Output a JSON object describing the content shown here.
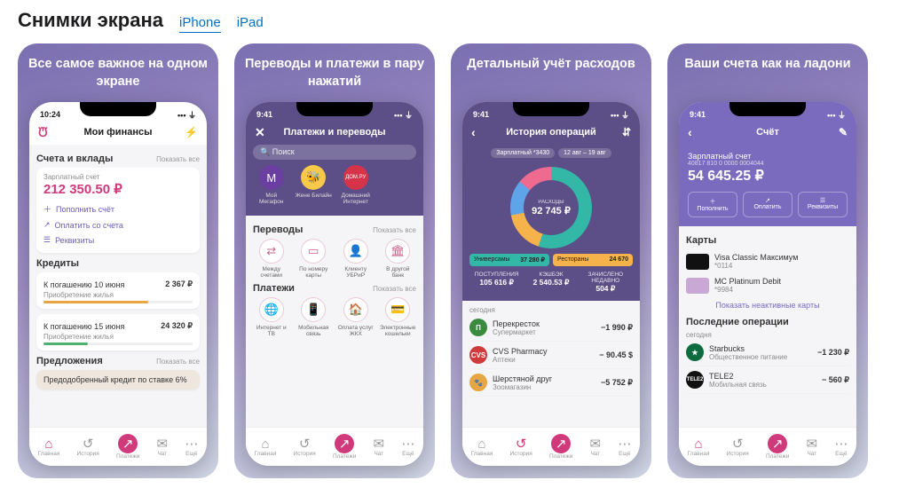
{
  "header": {
    "title": "Снимки экрана",
    "tab_iphone": "iPhone",
    "tab_ipad": "iPad"
  },
  "common": {
    "show_all": "Показать все",
    "today": "сегодня"
  },
  "tabbar": {
    "home": "Главная",
    "history": "История",
    "payments": "Платежи",
    "chat": "Чат",
    "more": "Ещё"
  },
  "shot1": {
    "caption": "Все самое важное на одном экране",
    "time": "10:24",
    "screen_title": "Мои финансы",
    "sec_accounts": "Счета и вклады",
    "account_name": "Зарплатный счет",
    "account_balance": "212 350.50 ₽",
    "act_topup": "Пополнить счёт",
    "act_pay": "Оплатить со счета",
    "act_details": "Реквизиты",
    "sec_credits": "Кредиты",
    "credit1_t": "К погашению 10 июня",
    "credit1_v": "2 367 ₽",
    "credit1_s": "Приобретение жилья",
    "credit2_t": "К погашению 15 июня",
    "credit2_v": "24 320 ₽",
    "credit2_s": "Приобретение жилья",
    "sec_offers": "Предложения",
    "offer": "Предодобренный кредит по ставке 6%"
  },
  "shot2": {
    "caption": "Переводы и платежи в пару нажатий",
    "time": "9:41",
    "screen_title": "Платежи и переводы",
    "search_ph": "Поиск",
    "fav1": "Мой Мегафон",
    "fav2": "Жене Билайн",
    "fav3": "Домашний Интернет",
    "sec_transfers": "Переводы",
    "t1": "Между счетами",
    "t2": "По номеру карты",
    "t3": "Клиенту УБРиР",
    "t4": "В другой банк",
    "sec_payments": "Платежи",
    "p1": "Интернет и ТВ",
    "p2": "Мобильная связь",
    "p3": "Оплата услуг ЖКХ",
    "p4": "Электронные кошельки"
  },
  "shot3": {
    "caption": "Детальный учёт расходов",
    "time": "9:41",
    "screen_title": "История операций",
    "pill_card": "Зарплатный *3430",
    "pill_period": "12 авг – 19 авг",
    "donut_label": "РАСХОДЫ",
    "donut_value": "92 745 ₽",
    "chip1_t": "Универсамы",
    "chip1_v": "37 280 ₽",
    "chip2_t": "Рестораны",
    "chip2_v": "24 670",
    "stat1_l": "ПОСТУПЛЕНИЯ",
    "stat1_v": "105 616 ₽",
    "stat2_l": "КЭШБЭК",
    "stat2_v": "2 540.53 ₽",
    "stat3_l": "ЗАЧИСЛЕНО НЕДАВНО",
    "stat3_v": "504 ₽",
    "op1_t": "Перекресток",
    "op1_s": "Супермаркет",
    "op1_v": "−1 990 ₽",
    "op2_t": "CVS Pharmacy",
    "op2_s": "Аптеки",
    "op2_v": "− 90.45 $",
    "op3_t": "Шерстяной друг",
    "op3_s": "Зоомагазин",
    "op3_v": "−5 752 ₽"
  },
  "shot4": {
    "caption": "Ваши счета как на ладони",
    "time": "9:41",
    "screen_title": "Счёт",
    "account_name": "Зарплатный счет",
    "account_sub": "40817 810 0 0000 0004044",
    "balance": "54 645.25 ₽",
    "a1": "Пополнить",
    "a2": "Оплатить",
    "a3": "Реквизиты",
    "sec_cards": "Карты",
    "card1_t": "Visa Classic Максимум",
    "card1_s": "*0114",
    "card2_t": "MC Platinum Debit",
    "card2_s": "*9984",
    "show_inactive": "Показать неактивные карты",
    "sec_ops": "Последние операции",
    "o1_t": "Starbucks",
    "o1_s": "Общественное питание",
    "o1_v": "−1 230 ₽",
    "o2_t": "TELE2",
    "o2_s": "Мобильная связь",
    "o2_v": "− 560 ₽"
  }
}
